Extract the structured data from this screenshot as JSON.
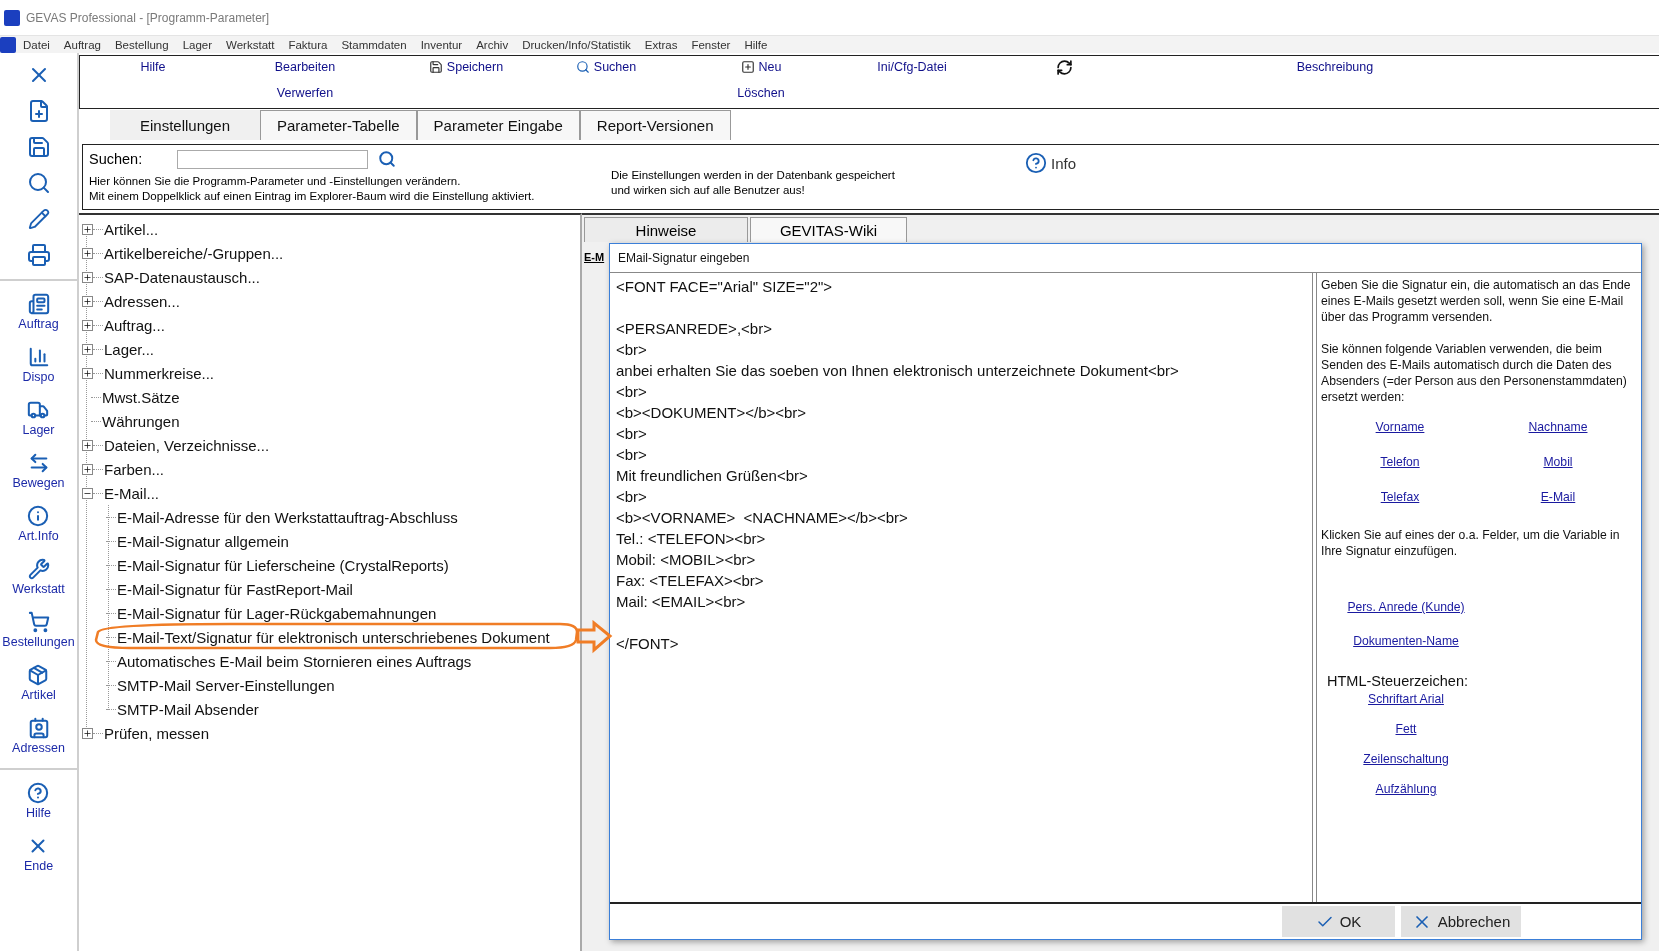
{
  "window": {
    "title": "GEVAS Professional - [Programm-Parameter]"
  },
  "menu": [
    "Datei",
    "Auftrag",
    "Bestellung",
    "Lager",
    "Werkstatt",
    "Faktura",
    "Stammdaten",
    "Inventur",
    "Archiv",
    "Drucken/Info/Statistik",
    "Extras",
    "Fenster",
    "Hilfe"
  ],
  "sidebar": {
    "groups": [
      {
        "items": [
          "Auftrag",
          "Dispo",
          "Lager",
          "Bewegen",
          "Art.Info",
          "Werkstatt",
          "Bestellungen",
          "Artikel",
          "Adressen"
        ]
      },
      {
        "items": [
          "Hilfe",
          "Ende"
        ]
      }
    ]
  },
  "toolbar": {
    "columns": [
      {
        "kind": "text",
        "buttons": [
          "Hilfe"
        ]
      },
      {
        "kind": "text",
        "buttons": [
          "Bearbeiten",
          "Verwerfen"
        ]
      },
      {
        "kind": "text",
        "buttons": [
          "Speichern"
        ]
      },
      {
        "kind": "text",
        "buttons": [
          "Suchen"
        ]
      },
      {
        "kind": "text",
        "buttons": [
          "Neu",
          "Löschen"
        ]
      },
      {
        "kind": "text",
        "buttons": [
          "Ini/Cfg-Datei"
        ]
      },
      {
        "kind": "icon"
      },
      {
        "kind": "text",
        "buttons": [
          "Beschreibung"
        ]
      }
    ]
  },
  "tabs": [
    {
      "label": "Einstellungen",
      "selected": true
    },
    {
      "label": "Parameter-Tabelle",
      "selected": false
    },
    {
      "label": "Parameter Eingabe",
      "selected": false
    },
    {
      "label": "Report-Versionen",
      "selected": false
    }
  ],
  "search": {
    "label": "Suchen:",
    "hint": [
      "Hier können Sie die Programm-Parameter und -Einstellungen verändern.",
      "Mit einem Doppelklick auf einen Eintrag im Explorer-Baum wird die Einstellung  aktiviert."
    ],
    "note": [
      "Die Einstellungen werden in der Datenbank gespeichert",
      "und wirken sich auf alle Benutzer aus!"
    ],
    "info_button": "Info"
  },
  "tree": [
    {
      "kind": "folder",
      "label": "Artikel...",
      "expanded": false
    },
    {
      "kind": "folder",
      "label": "Artikelbereiche/-Gruppen...",
      "expanded": false
    },
    {
      "kind": "folder",
      "label": "SAP-Datenaustausch...",
      "expanded": false
    },
    {
      "kind": "folder",
      "label": "Adressen...",
      "expanded": false
    },
    {
      "kind": "folder",
      "label": "Auftrag...",
      "expanded": false
    },
    {
      "kind": "folder",
      "label": "Lager...",
      "expanded": false
    },
    {
      "kind": "folder",
      "label": "Nummerkreise...",
      "expanded": false
    },
    {
      "kind": "leaf",
      "label": "Mwst.Sätze"
    },
    {
      "kind": "leaf",
      "label": "Währungen"
    },
    {
      "kind": "folder",
      "label": "Dateien, Verzeichnisse...",
      "expanded": false
    },
    {
      "kind": "folder",
      "label": "Farben...",
      "expanded": false
    },
    {
      "kind": "folder",
      "label": "E-Mail...",
      "expanded": true,
      "children": [
        {
          "kind": "leaf",
          "label": "E-Mail-Adresse für den Werkstattauftrag-Abschluss"
        },
        {
          "kind": "leaf",
          "label": "E-Mail-Signatur allgemein"
        },
        {
          "kind": "leaf",
          "label": "E-Mail-Signatur für Lieferscheine (CrystalReports)"
        },
        {
          "kind": "leaf",
          "label": "E-Mail-Signatur für FastReport-Mail"
        },
        {
          "kind": "leaf",
          "label": "E-Mail-Signatur für Lager-Rückgabemahnungen"
        },
        {
          "kind": "leaf",
          "label": "E-Mail-Text/Signatur für elektronisch unterschriebenes Dokument"
        },
        {
          "kind": "leaf",
          "label": "Automatisches E-Mail beim Stornieren eines Auftrags"
        },
        {
          "kind": "leaf",
          "label": "SMTP-Mail Server-Einstellungen"
        },
        {
          "kind": "leaf",
          "label": "SMTP-Mail Absender"
        }
      ]
    },
    {
      "kind": "folder",
      "label": "Prüfen, messen",
      "expanded": false
    }
  ],
  "right_tabs": [
    {
      "label": "Hinweise",
      "selected": true
    },
    {
      "label": "GEVITAS-Wiki",
      "selected": false
    }
  ],
  "right_heading": "E-M",
  "dialog": {
    "title": "EMail-Signatur eingeben",
    "editor": {
      "value": "<FONT FACE=\"Arial\" SIZE=\"2\">\n\n<PERSANREDE>,<br>\n<br>\nanbei erhalten Sie das soeben von Ihnen elektronisch unterzeichnete Dokument<br>\n<br>\n<b><DOKUMENT></b><br>\n<br>\n<br>\nMit freundlichen Grüßen<br>\n<br>\n<b><VORNAME>  <NACHNAME></b><br>\nTel.: <TELEFON><br>\nMobil: <MOBIL><br>\nFax: <TELEFAX><br>\nMail: <EMAIL><br>\n\n</FONT>"
    },
    "help": {
      "intro": "Geben Sie die Signatur ein, die automatisch an das Ende eines E-Mails gesetzt werden soll, wenn Sie eine E-Mail über das Programm versenden.",
      "variables_text": "Sie können folgende Variablen verwenden, die beim Senden des E-Mails automatisch durch die Daten des Absenders (=der Person aus den Personenstammdaten) ersetzt werden:",
      "variable_links": [
        "Vorname",
        "Nachname",
        "Telefon",
        "Mobil",
        "Telefax",
        "E-Mail"
      ],
      "click_text": "Klicken Sie auf eines der o.a. Felder, um die Variable in Ihre Signatur einzufügen.",
      "customer_links": [
        "Pers. Anrede (Kunde)",
        "Dokumenten-Name"
      ],
      "html_heading": "HTML-Steuerzeichen:",
      "html_links": [
        "Schriftart Arial",
        "Fett",
        "Zeilenschaltung",
        "Aufzählung"
      ]
    },
    "buttons": [
      {
        "kind": "ok",
        "label": "OK"
      },
      {
        "kind": "cancel",
        "label": "Abbrechen"
      }
    ]
  }
}
